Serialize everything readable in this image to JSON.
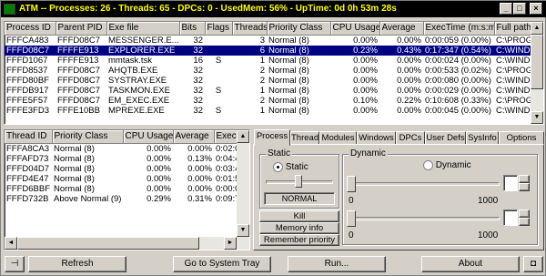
{
  "titlebar": {
    "text": "ATM -- Processes: 26 - Threads: 65 - DPCs: 0 - UsedMem: 56% - UpTime: 0d 0h 53m 28s",
    "minimize": "_",
    "maximize": "□",
    "close": "×"
  },
  "process_table": {
    "columns": [
      "Process ID",
      "Parent PID",
      "Exe file",
      "Bits",
      "Flags",
      "Threads",
      "Priority Class",
      "CPU Usage",
      "Average",
      "ExecTime (m:s:ms)",
      "Full path"
    ],
    "rows": [
      [
        "FFFCA483",
        "FFFD08C7",
        "MESSENGER.E...",
        "32",
        "",
        "3",
        "Normal (8)",
        "0.00%",
        "0.00%",
        "0:00:059 (0.00%)",
        "C:\\PROGR"
      ],
      [
        "FFFD08C7",
        "FFFFE913",
        "EXPLORER.EXE",
        "32",
        "",
        "6",
        "Normal (8)",
        "0.23%",
        "0.43%",
        "0:17:347 (0.54%)",
        "C:\\WINDO"
      ],
      [
        "FFFD1067",
        "FFFFE913",
        "mmtask.tsk",
        "16",
        "S",
        "1",
        "Normal (8)",
        "0.00%",
        "0.00%",
        "0:00:024 (0.00%)",
        "C:\\WINDO"
      ],
      [
        "FFFD8537",
        "FFFD08C7",
        "AHQTB.EXE",
        "32",
        "",
        "2",
        "Normal (8)",
        "0.00%",
        "0.00%",
        "0:00:533 (0.02%)",
        "C:\\PROGR"
      ],
      [
        "FFFD80BF",
        "FFFD08C7",
        "SYSTRAY.EXE",
        "32",
        "",
        "2",
        "Normal (8)",
        "0.00%",
        "0.00%",
        "0:00:080 (0.00%)",
        "C:\\WINDO"
      ],
      [
        "FFFDB917",
        "FFFD08C7",
        "TASKMON.EXE",
        "32",
        "S",
        "1",
        "Normal (8)",
        "0.00%",
        "0.00%",
        "0:00:029 (0.00%)",
        "C:\\WINDO"
      ],
      [
        "FFFE5F57",
        "FFFD08C7",
        "EM_EXEC.EXE",
        "32",
        "",
        "2",
        "Normal (8)",
        "0.10%",
        "0.22%",
        "0:10:608 (0.33%)",
        "C:\\PROGR"
      ],
      [
        "FFFE3FD3",
        "FFFE10BB",
        "MPREXE.EXE",
        "32",
        "S",
        "1",
        "Normal (8)",
        "0.00%",
        "0.00%",
        "0:00:045 (0.00%)",
        "C:\\WINDO"
      ]
    ],
    "selected_row": 1
  },
  "thread_table": {
    "columns": [
      "Thread ID",
      "Priority Class",
      "CPU Usage",
      "Average",
      "ExecTi"
    ],
    "rows": [
      [
        "FFFA8CA3",
        "Normal (8)",
        "0.00%",
        "0.00%",
        "0:02:0"
      ],
      [
        "FFFAFD73",
        "Normal (8)",
        "0.00%",
        "0.13%",
        "0:04:4"
      ],
      [
        "FFFD04D7",
        "Normal (8)",
        "0.00%",
        "0.00%",
        "0:03:4"
      ],
      [
        "FFFD4E47",
        "Normal (8)",
        "0.00%",
        "0.00%",
        "0:01:5"
      ],
      [
        "FFFD6BBF",
        "Normal (8)",
        "0.00%",
        "0.00%",
        "0:00:0"
      ],
      [
        "FFFD732B",
        "Above Normal (9)",
        "0.29%",
        "0.31%",
        "0:09:7"
      ]
    ]
  },
  "tabs": [
    "Process",
    "Thread",
    "Modules",
    "Windows",
    "DPCs",
    "User Defs",
    "SysInfo",
    "Options"
  ],
  "process_panel": {
    "static_group": "Static",
    "static_radio": "Static",
    "static_value": "NORMAL",
    "dynamic_group": "Dynamic",
    "dynamic_radio": "Dynamic",
    "slider1_min": "0",
    "slider1_max": "1000",
    "slider2_min": "0",
    "slider2_max": "1000",
    "kill_button": "Kill",
    "memory_button": "Memory info",
    "remember_button": "Remember priority"
  },
  "bottom": {
    "refresh": "Refresh",
    "systray": "Go to System Tray",
    "run": "Run...",
    "about": "About"
  }
}
